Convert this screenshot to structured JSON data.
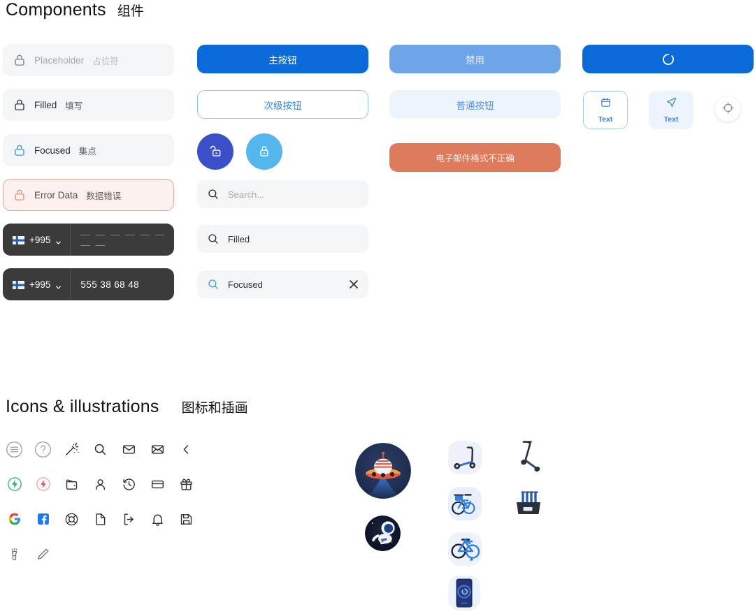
{
  "sections": {
    "components": {
      "title_en": "Components",
      "title_zh": "组件"
    },
    "icons": {
      "title_en": "Icons & illustrations",
      "title_zh": "图标和插画"
    }
  },
  "colors": {
    "primary_blue": "#0a6ad8",
    "secondary_blue_border": "#8ec4f2",
    "disabled_blue": "#6da5e8",
    "plain_bg": "#eef4fc",
    "plain_text": "#5b90d8",
    "error_orange": "#dd7b5c",
    "error_field_bg": "#fcf1ee",
    "error_field_border": "#e8a68f",
    "field_bg": "#f4f5f7",
    "phone_bg": "#3b3b3b",
    "circle_dark": "#3b50c8",
    "circle_light": "#54b6ec",
    "focus_blue": "#3f9ae0"
  },
  "text_fields": [
    {
      "icon": "lock-icon",
      "state": "placeholder",
      "label_en": "Placeholder",
      "label_zh": "占位符"
    },
    {
      "icon": "lock-icon",
      "state": "filled",
      "label_en": "Filled",
      "label_zh": "填写"
    },
    {
      "icon": "lock-icon",
      "state": "focused",
      "label_en": "Focused",
      "label_zh": "集点"
    },
    {
      "icon": "lock-icon",
      "state": "error",
      "label_en": "Error Data",
      "label_zh": "数据错误"
    }
  ],
  "phone_fields": [
    {
      "flag": "finland-flag-icon",
      "country_code": "+995",
      "chevron": "chevron-down-icon",
      "value": "— — — — — — — —",
      "state": "empty"
    },
    {
      "flag": "finland-flag-icon",
      "country_code": "+995",
      "chevron": "chevron-down-icon",
      "value": "555 38 68 48",
      "state": "filled"
    }
  ],
  "buttons": {
    "primary": "主按钮",
    "secondary": "次级按钮",
    "disabled": "禁用",
    "plain": "普通按钮",
    "error": "电子邮件格式不正确",
    "loading_icon": "loading-spinner-icon"
  },
  "circle_buttons": [
    {
      "icon": "unlock-icon",
      "variant": "dark"
    },
    {
      "icon": "lock-icon",
      "variant": "light"
    }
  ],
  "search_fields": [
    {
      "icon": "search-icon",
      "state": "placeholder",
      "value": "Search..."
    },
    {
      "icon": "search-icon",
      "state": "filled",
      "value": "Filled"
    },
    {
      "icon": "search-icon",
      "state": "focused",
      "value": "Focused",
      "clear_icon": "close-icon"
    }
  ],
  "tiles": [
    {
      "icon": "calendar-icon",
      "label": "Text",
      "variant": "outlined"
    },
    {
      "icon": "send-icon",
      "label": "Text",
      "variant": "filled"
    }
  ],
  "fab": {
    "icon": "crosshair-icon"
  },
  "icon_grid": [
    [
      {
        "name": "menu-circle-icon"
      },
      {
        "name": "help-circle-icon"
      },
      {
        "name": "magic-wand-icon"
      },
      {
        "name": "search-icon"
      },
      {
        "name": "mail-closed-icon"
      },
      {
        "name": "mail-open-icon"
      },
      {
        "name": "chevron-left-icon"
      }
    ],
    [
      {
        "name": "bolt-circle-green-icon"
      },
      {
        "name": "bolt-circle-red-icon"
      },
      {
        "name": "wallet-icon"
      },
      {
        "name": "user-icon"
      },
      {
        "name": "history-icon"
      },
      {
        "name": "card-icon"
      },
      {
        "name": "gift-icon"
      }
    ],
    [
      {
        "name": "google-icon"
      },
      {
        "name": "facebook-icon"
      },
      {
        "name": "lifebuoy-icon"
      },
      {
        "name": "document-icon"
      },
      {
        "name": "logout-icon"
      },
      {
        "name": "bell-icon"
      },
      {
        "name": "save-icon"
      }
    ],
    [
      {
        "name": "flashlight-icon"
      },
      {
        "name": "pencil-icon"
      }
    ]
  ],
  "illustrations": [
    {
      "name": "ufo-illustration",
      "shape": "round"
    },
    {
      "name": "astronaut-illustration",
      "shape": "round"
    },
    {
      "name": "scooter-tile-illustration",
      "shape": "tile"
    },
    {
      "name": "scooter-tilted-illustration",
      "shape": "plain"
    },
    {
      "name": "bicycle-tile-illustration",
      "shape": "tile"
    },
    {
      "name": "scooter-dock-illustration",
      "shape": "plain"
    },
    {
      "name": "bicycle-blue-illustration",
      "shape": "tile"
    },
    {
      "name": "phone-app-illustration",
      "shape": "tile"
    }
  ]
}
